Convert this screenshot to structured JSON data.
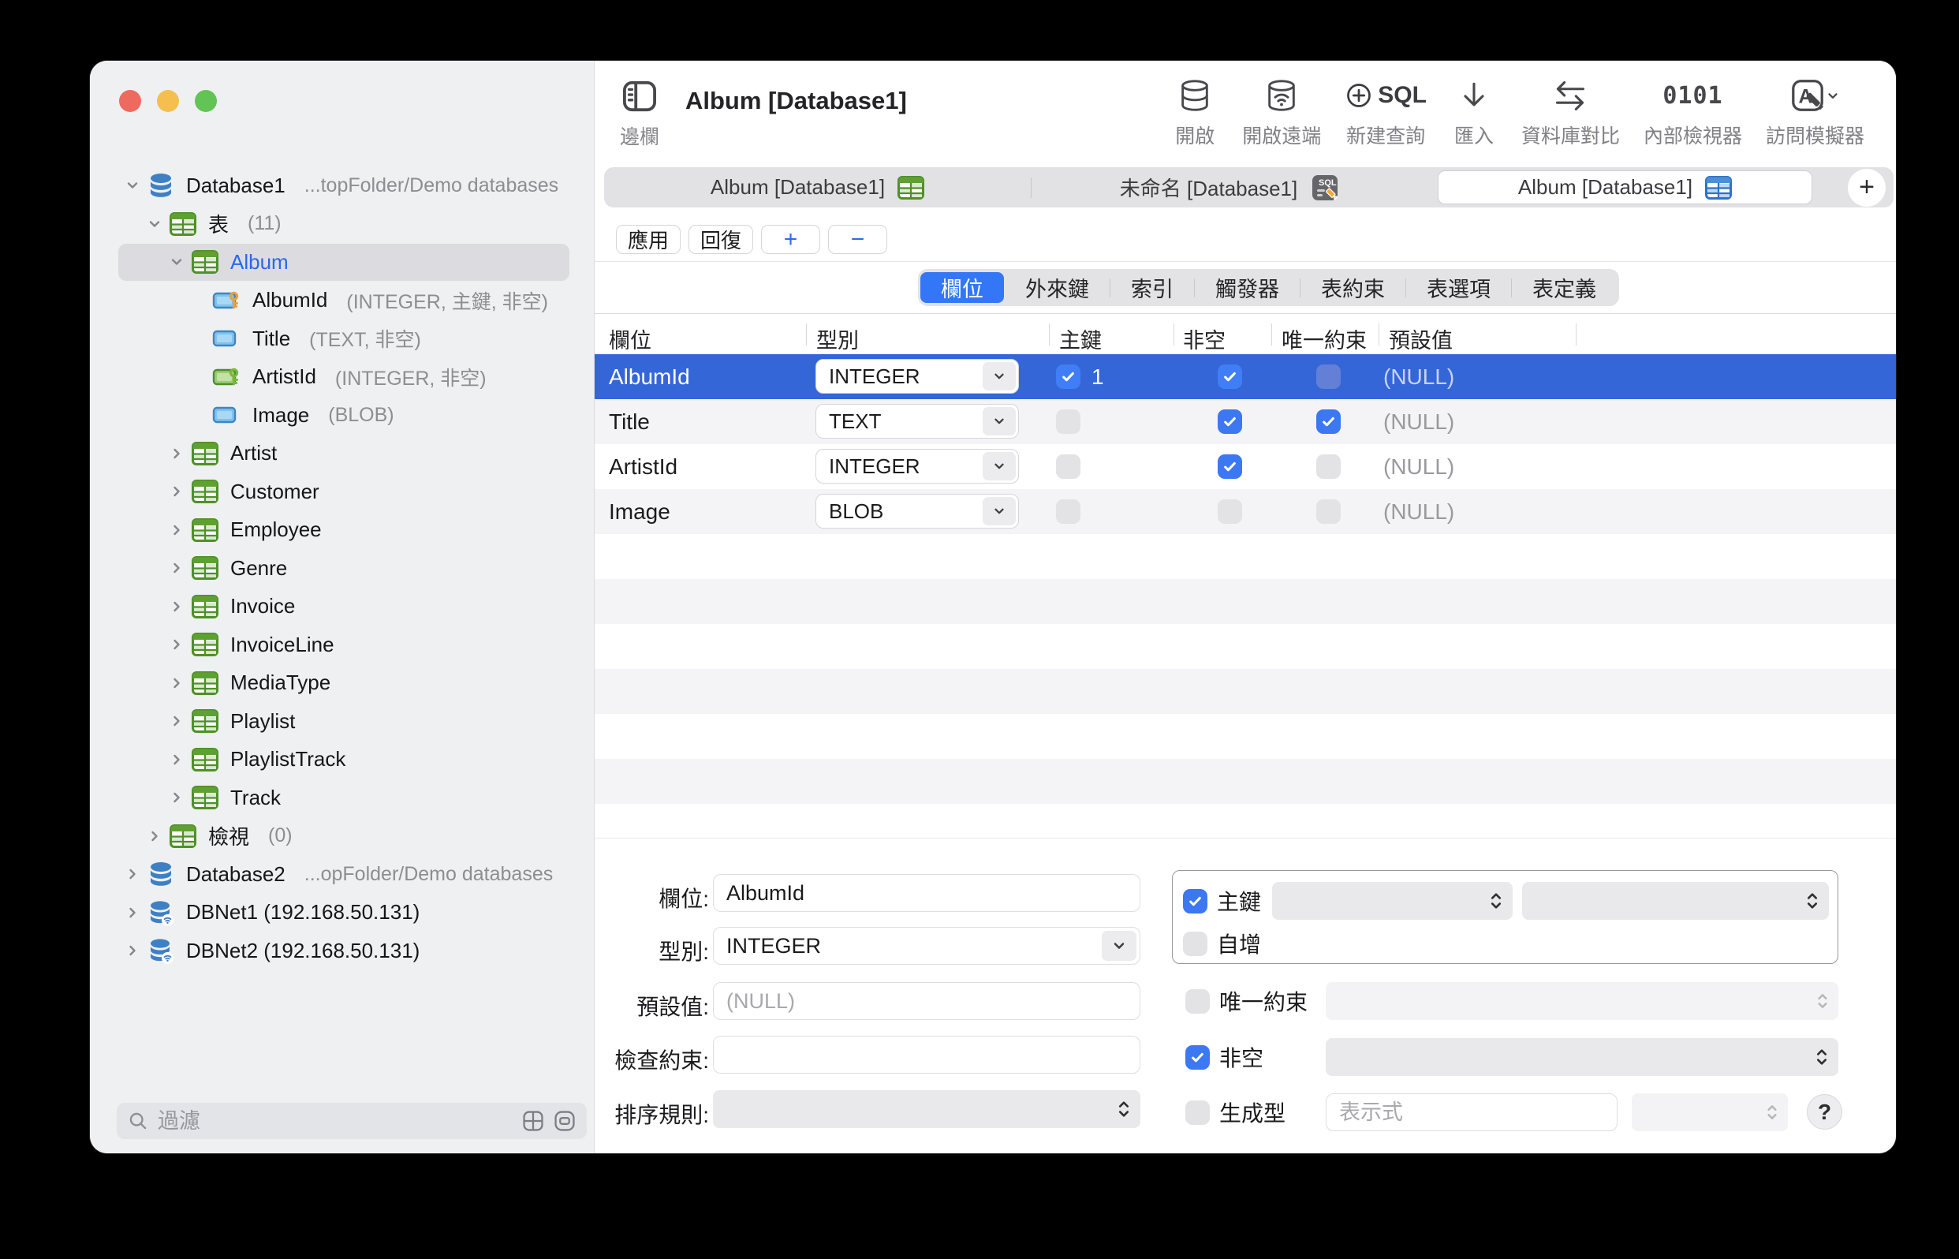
{
  "window": {
    "title": "Album [Database1]",
    "sidebar_toggle_label": "邊欄",
    "toolbar": [
      {
        "label": "開啟",
        "icon": "open-database-icon"
      },
      {
        "label": "開啟遠端",
        "icon": "open-remote-database-icon"
      },
      {
        "label": "新建查詢",
        "icon": "new-query-icon",
        "icon_text": "SQL"
      },
      {
        "label": "匯入",
        "icon": "import-icon"
      },
      {
        "label": "資料庫對比",
        "icon": "database-compare-icon"
      },
      {
        "label": "內部檢視器",
        "icon": "hex-viewer-icon",
        "icon_text": "0101"
      },
      {
        "label": "訪問模擬器",
        "icon": "simulator-access-icon"
      }
    ],
    "tabs": [
      {
        "label": "Album [Database1]",
        "icon": "table-green-icon",
        "active": false
      },
      {
        "label": "未命名 [Database1]",
        "icon": "sql-editor-icon",
        "active": false
      },
      {
        "label": "Album [Database1]",
        "icon": "table-blue-icon",
        "active": true
      }
    ],
    "tab_add_label": "+",
    "actions": {
      "apply": "應用",
      "revert": "回復",
      "add": "+",
      "remove": "−"
    },
    "segments": [
      {
        "label": "欄位",
        "selected": true
      },
      {
        "label": "外來鍵",
        "selected": false
      },
      {
        "label": "索引",
        "selected": false
      },
      {
        "label": "觸發器",
        "selected": false
      },
      {
        "label": "表約束",
        "selected": false
      },
      {
        "label": "表選項",
        "selected": false
      },
      {
        "label": "表定義",
        "selected": false
      }
    ],
    "grid": {
      "headers": [
        "欄位",
        "型別",
        "主鍵",
        "非空",
        "唯一約束",
        "預設值"
      ],
      "rows": [
        {
          "name": "AlbumId",
          "type": "INTEGER",
          "pk": true,
          "pk_order": "1",
          "notnull": true,
          "unique": false,
          "default": "(NULL)",
          "selected": true
        },
        {
          "name": "Title",
          "type": "TEXT",
          "pk": false,
          "pk_order": "",
          "notnull": true,
          "unique": true,
          "default": "(NULL)",
          "selected": false
        },
        {
          "name": "ArtistId",
          "type": "INTEGER",
          "pk": false,
          "pk_order": "",
          "notnull": true,
          "unique": false,
          "default": "(NULL)",
          "selected": false
        },
        {
          "name": "Image",
          "type": "BLOB",
          "pk": false,
          "pk_order": "",
          "notnull": false,
          "unique": false,
          "default": "(NULL)",
          "selected": false
        }
      ]
    },
    "form": {
      "field_label": "欄位:",
      "field_value": "AlbumId",
      "type_label": "型別:",
      "type_value": "INTEGER",
      "default_label": "預設值:",
      "default_placeholder": "(NULL)",
      "check_label": "檢查約束:",
      "check_value": "",
      "collation_label": "排序規則:",
      "pk_label": "主鍵",
      "pk_checked": true,
      "autoincrement_label": "自增",
      "autoincrement_checked": false,
      "unique_label": "唯一約束",
      "unique_checked": false,
      "notnull_label": "非空",
      "notnull_checked": true,
      "generated_label": "生成型",
      "generated_checked": false,
      "expression_placeholder": "表示式",
      "help_label": "?"
    }
  },
  "sidebar": {
    "filter_placeholder": "過濾",
    "tree": [
      {
        "level": 1,
        "chevron": "down",
        "icon": "database",
        "label": "Database1",
        "detail": "...topFolder/Demo databases"
      },
      {
        "level": 2,
        "chevron": "down",
        "icon": "table",
        "label": "表",
        "detail": "(11)"
      },
      {
        "level": 3,
        "chevron": "down",
        "icon": "table",
        "label": "Album",
        "selected": true,
        "accent": true
      },
      {
        "level": 4,
        "chevron": null,
        "icon": "column-pk",
        "label": "AlbumId",
        "detail": "(INTEGER, 主鍵, 非空)"
      },
      {
        "level": 4,
        "chevron": null,
        "icon": "column",
        "label": "Title",
        "detail": "(TEXT, 非空)"
      },
      {
        "level": 4,
        "chevron": null,
        "icon": "column-fk",
        "label": "ArtistId",
        "detail": "(INTEGER, 非空)"
      },
      {
        "level": 4,
        "chevron": null,
        "icon": "column",
        "label": "Image",
        "detail": "(BLOB)"
      },
      {
        "level": 3,
        "chevron": "right",
        "icon": "table",
        "label": "Artist"
      },
      {
        "level": 3,
        "chevron": "right",
        "icon": "table",
        "label": "Customer"
      },
      {
        "level": 3,
        "chevron": "right",
        "icon": "table",
        "label": "Employee"
      },
      {
        "level": 3,
        "chevron": "right",
        "icon": "table",
        "label": "Genre"
      },
      {
        "level": 3,
        "chevron": "right",
        "icon": "table",
        "label": "Invoice"
      },
      {
        "level": 3,
        "chevron": "right",
        "icon": "table",
        "label": "InvoiceLine"
      },
      {
        "level": 3,
        "chevron": "right",
        "icon": "table",
        "label": "MediaType"
      },
      {
        "level": 3,
        "chevron": "right",
        "icon": "table",
        "label": "Playlist"
      },
      {
        "level": 3,
        "chevron": "right",
        "icon": "table",
        "label": "PlaylistTrack"
      },
      {
        "level": 3,
        "chevron": "right",
        "icon": "table",
        "label": "Track"
      },
      {
        "level": 2,
        "chevron": "right",
        "icon": "table",
        "label": "檢視",
        "detail": "(0)"
      },
      {
        "level": 1,
        "chevron": "right",
        "icon": "database",
        "label": "Database2",
        "detail": "...opFolder/Demo databases"
      },
      {
        "level": 1,
        "chevron": "right",
        "icon": "database-net",
        "label": "DBNet1 (192.168.50.131)"
      },
      {
        "level": 1,
        "chevron": "right",
        "icon": "database-net",
        "label": "DBNet2 (192.168.50.131)"
      }
    ]
  },
  "colors": {
    "selection_blue": "#3566d8",
    "checkbox_blue": "#3b78f2",
    "segment_blue": "#3477f6",
    "accent_text_blue": "#2968e8",
    "table_icon_green": "#4f9027",
    "database_icon_blue": "#3e80c4",
    "key_orange": "#e8a23c",
    "key_green": "#7ab53e",
    "stripe_gray": "#f4f4f6",
    "sidebar_bg": "#eff0f2"
  }
}
